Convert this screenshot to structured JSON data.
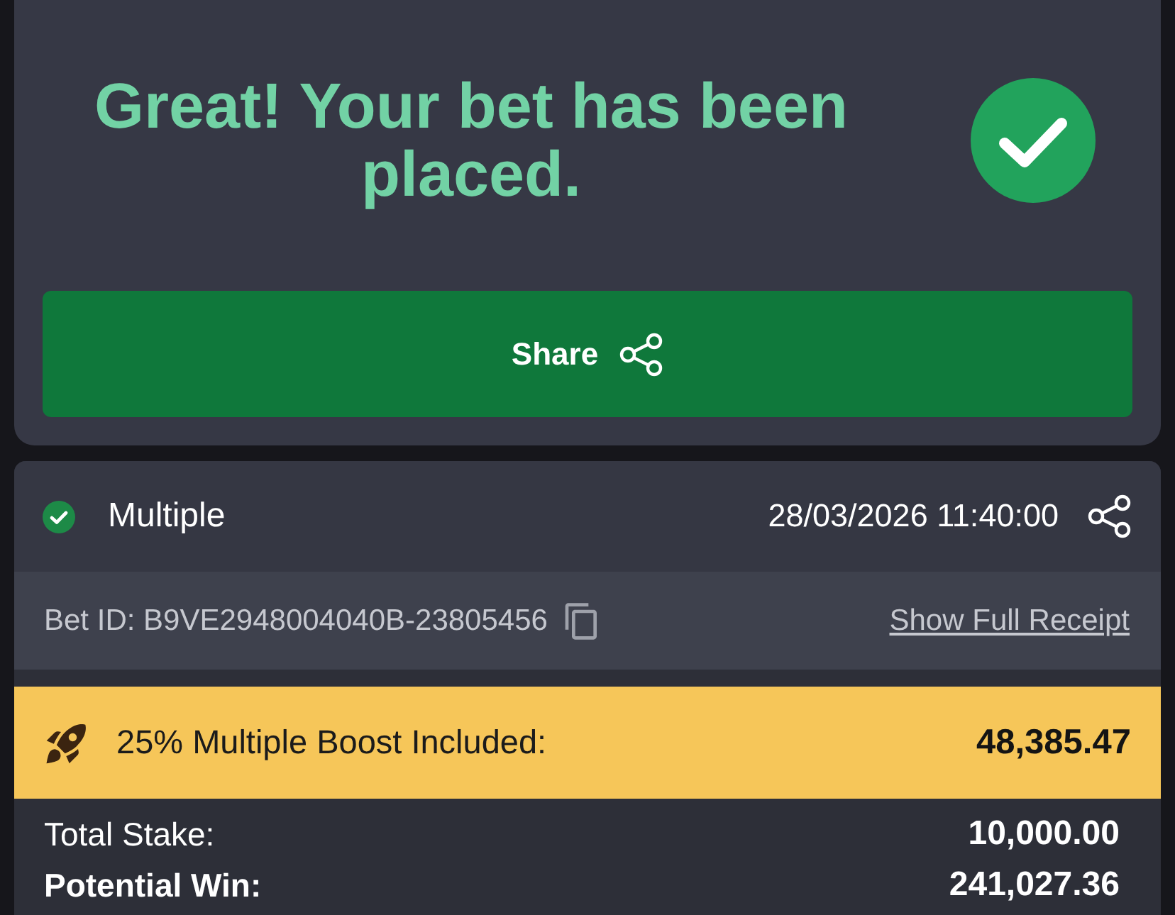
{
  "confirmation": {
    "title": "Great! Your bet has been placed.",
    "share_button": {
      "label": "Share"
    }
  },
  "bet": {
    "type": "Multiple",
    "placed_at": "28/03/2026 11:40:00",
    "bet_id": "Bet ID: B9VE2948004040B-23805456",
    "receipt_link": "Show Full Receipt"
  },
  "boost": {
    "label": "25% Multiple Boost Included:",
    "amount": "48,385.47"
  },
  "totals": [
    {
      "kind": "stake",
      "label": "Total Stake:",
      "value": "10,000.00"
    },
    {
      "kind": "win",
      "label": "Potential Win:",
      "value": "241,027.36"
    }
  ]
}
